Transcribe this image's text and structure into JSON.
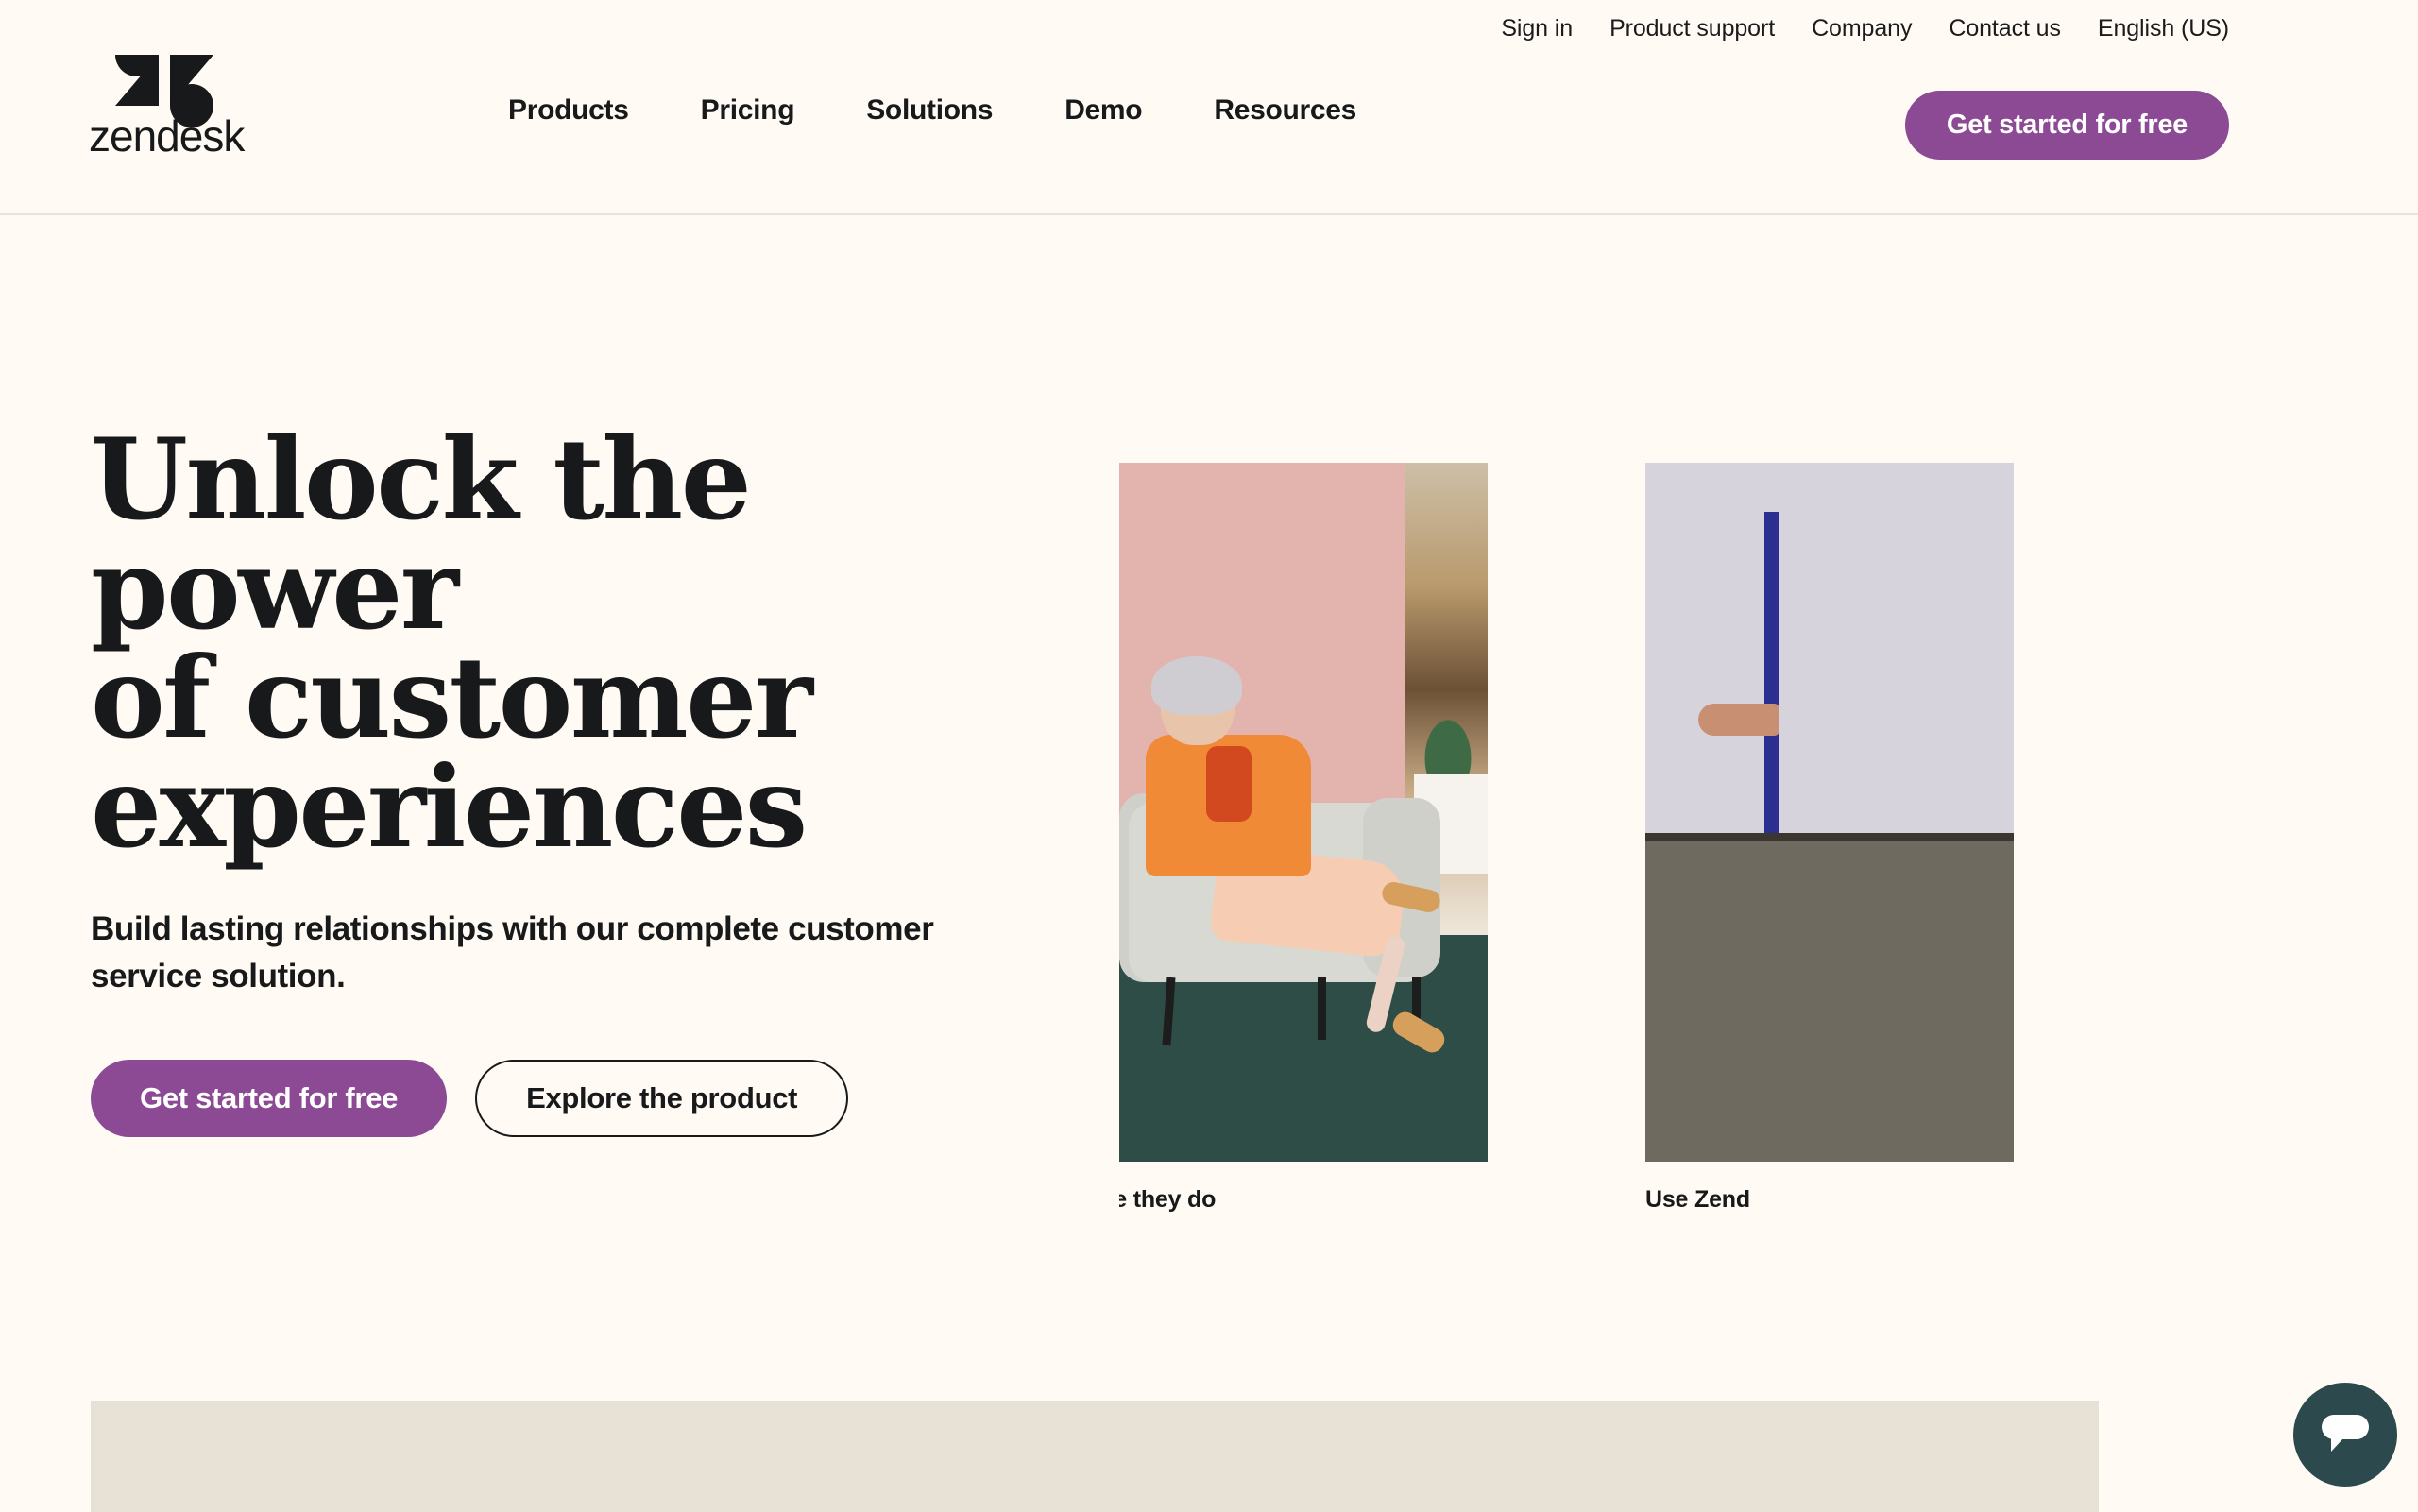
{
  "brand": {
    "name": "zendesk",
    "logo_icon": "zendesk-logo",
    "accent_purple": "#8c4a95",
    "background": "#fffaf3",
    "text": "#17191a"
  },
  "header": {
    "utility_nav": [
      {
        "label": "Sign in"
      },
      {
        "label": "Product support"
      },
      {
        "label": "Company"
      },
      {
        "label": "Contact us"
      },
      {
        "label": "English (US)"
      }
    ],
    "main_nav": [
      {
        "label": "Products"
      },
      {
        "label": "Pricing"
      },
      {
        "label": "Solutions"
      },
      {
        "label": "Demo"
      },
      {
        "label": "Resources"
      }
    ],
    "cta_label": "Get started for free"
  },
  "hero": {
    "title": "Unlock the power\nof customer\nexperiences",
    "subtitle": "Build lasting relationships with our complete customer\nservice solution.",
    "primary_cta": "Get started for free",
    "secondary_cta": "Explore the product"
  },
  "carousel": {
    "slides": [
      {
        "caption": "s need before they do",
        "image_alt": "woman-in-orange-blazer-seated-in-armchair"
      },
      {
        "caption": "Use Zend",
        "image_alt": "hand-reaching-past-blue-stripe-wall"
      }
    ]
  },
  "chat": {
    "icon": "chat-bubble-icon",
    "color": "#2c4a4e"
  }
}
